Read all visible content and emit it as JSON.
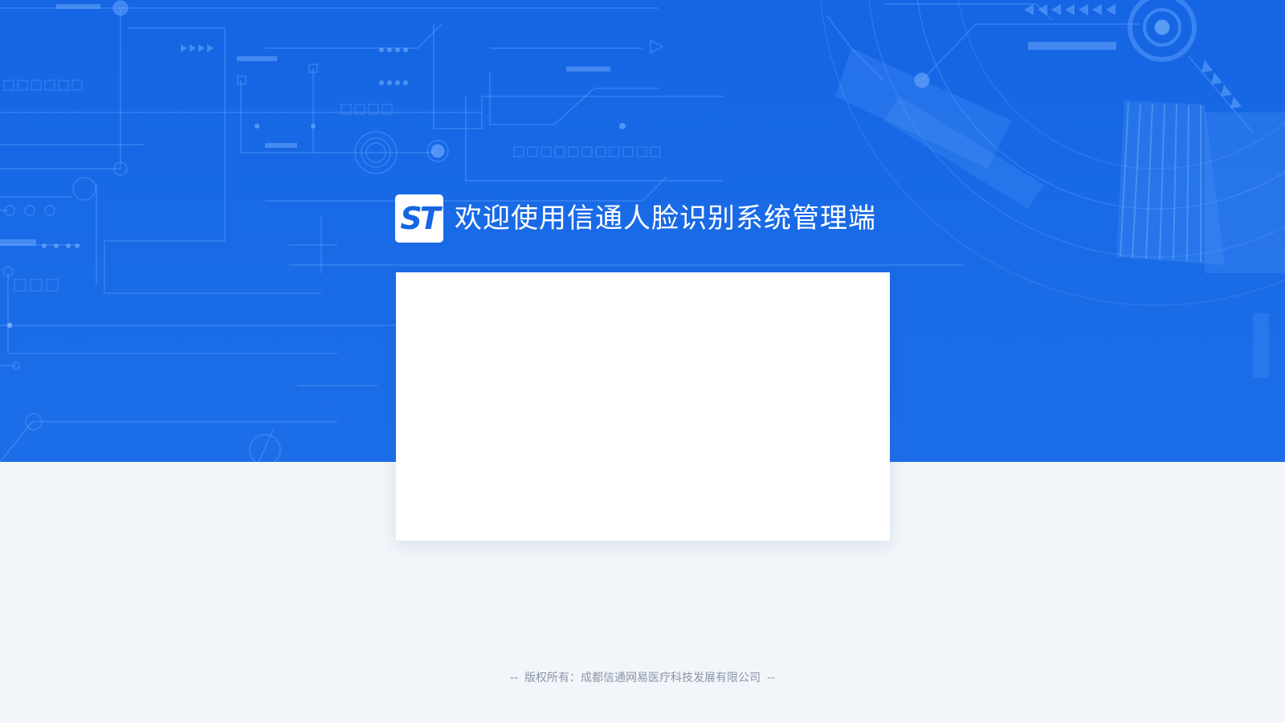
{
  "brand": {
    "logo_text": "ST",
    "welcome_title": "欢迎使用信通人脸识别系统管理端"
  },
  "footer": {
    "dash_left": "--",
    "copyright": "版权所有：成都信通网易医疗科技发展有限公司",
    "dash_right": "--"
  },
  "colors": {
    "hero_blue": "#1565e4",
    "page_background": "#f2f5fa",
    "card_background": "#ffffff",
    "footer_text": "#8a94a6"
  }
}
